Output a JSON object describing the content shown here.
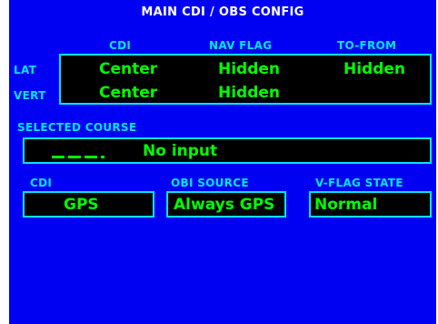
{
  "title": "MAIN CDI / OBS CONFIG",
  "table": {
    "headers": [
      "CDI",
      "NAV FLAG",
      "TO-FROM"
    ],
    "rows": [
      {
        "label": "LAT",
        "cdi": "Center",
        "nav_flag": "Hidden",
        "to_from": "Hidden"
      },
      {
        "label": "VERT",
        "cdi": "Center",
        "nav_flag": "Hidden",
        "to_from": ""
      }
    ]
  },
  "selected_course": {
    "label": "SELECTED COURSE",
    "value": "No input"
  },
  "settings": [
    {
      "label": "CDI",
      "value": "GPS"
    },
    {
      "label": "OBI SOURCE",
      "value": "Always GPS"
    },
    {
      "label": "V-FLAG STATE",
      "value": "Normal"
    }
  ],
  "colors": {
    "background": "#0000f2",
    "label": "#00e5ff",
    "value": "#00ff00",
    "title": "#ffffff",
    "box_border": "#00e5ff",
    "box_fill": "#000000"
  }
}
